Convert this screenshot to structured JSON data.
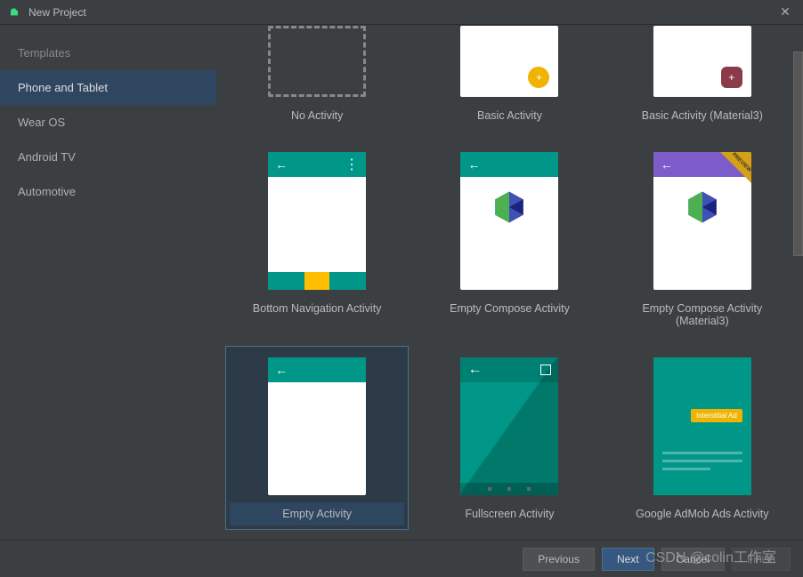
{
  "window": {
    "title": "New Project"
  },
  "sidebar": {
    "heading": "Templates",
    "items": [
      {
        "label": "Phone and Tablet",
        "selected": true
      },
      {
        "label": "Wear OS",
        "selected": false
      },
      {
        "label": "Android TV",
        "selected": false
      },
      {
        "label": "Automotive",
        "selected": false
      }
    ]
  },
  "templates": [
    {
      "label": "No Activity",
      "kind": "none"
    },
    {
      "label": "Basic Activity",
      "kind": "basic_yellow"
    },
    {
      "label": "Basic Activity (Material3)",
      "kind": "basic_maroon"
    },
    {
      "label": "Bottom Navigation Activity",
      "kind": "bottom_nav"
    },
    {
      "label": "Empty Compose Activity",
      "kind": "compose"
    },
    {
      "label": "Empty Compose Activity (Material3)",
      "kind": "compose_m3"
    },
    {
      "label": "Empty Activity",
      "kind": "empty",
      "selected": true
    },
    {
      "label": "Fullscreen Activity",
      "kind": "fullscreen"
    },
    {
      "label": "Google AdMob Ads Activity",
      "kind": "admob"
    }
  ],
  "admob_chip": "Interstitial Ad",
  "buttons": {
    "previous": "Previous",
    "next": "Next",
    "cancel": "Cancel",
    "finish": "Finish"
  },
  "watermark": "CSDN @colin工作室"
}
